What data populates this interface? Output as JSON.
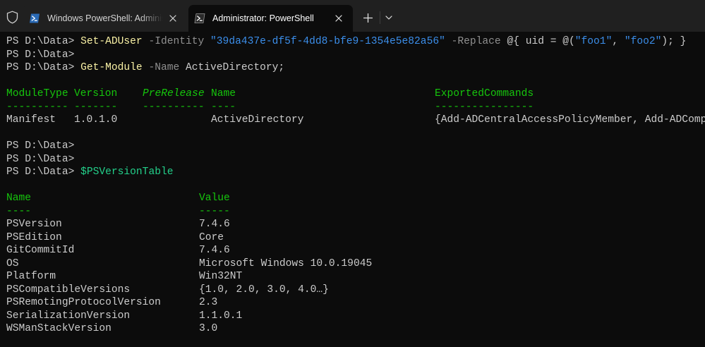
{
  "tabs": [
    {
      "title": "Windows PowerShell: Administrator: Windows PowerShell",
      "active": false
    },
    {
      "title": "Administrator: PowerShell",
      "active": true
    }
  ],
  "icons": {
    "shield": "shield-icon",
    "powershell": "powershell-icon",
    "close": "close-icon",
    "new_tab": "plus-icon",
    "dropdown": "chevron-down-icon"
  },
  "colors": {
    "background": "#0c0c0c",
    "tabbar": "#202020",
    "text": "#cccccc",
    "command": "#f9f1a5",
    "parameter": "#909090",
    "string": "#3b8eea",
    "variable": "#23d18b",
    "table_header": "#16c60c"
  },
  "terminal": {
    "prompt": "PS D:\\Data>",
    "line1": {
      "cmdlet": "Set-ADUser",
      "param_identity": "-Identity",
      "identity_value": "\"39da437e-df5f-4dd8-bfe9-1354e5e82a56\"",
      "param_replace": "-Replace",
      "hash_open": "@{ uid = @(",
      "value1": "\"foo1\"",
      "comma": ", ",
      "value2": "\"foo2\"",
      "hash_close": "); }"
    },
    "line3": {
      "cmdlet": "Get-Module",
      "param_name": "-Name",
      "name_value": "ActiveDirectory;"
    },
    "module_table": {
      "headers": {
        "module_type": "ModuleType",
        "version": "Version",
        "prerelease": "PreRelease",
        "name": "Name",
        "exported_commands": "ExportedCommands"
      },
      "underlines": {
        "module_type": "----------",
        "version": "-------",
        "prerelease": "----------",
        "name": "----",
        "exported_commands": "----------------"
      },
      "row": {
        "module_type": "Manifest",
        "version": "1.0.1.0",
        "prerelease": "",
        "name": "ActiveDirectory",
        "exported_commands": "{Add-ADCentralAccessPolicyMember, Add-ADComputerServiceAccount, Add-ADDomainControllerPasswordReplicationPolicy, Add-ADFineGrainedPasswordPolicySubject…}"
      }
    },
    "line_var": "$PSVersionTable",
    "version_table": {
      "headers": {
        "name": "Name",
        "value": "Value"
      },
      "underlines": {
        "name": "----",
        "value": "-----"
      },
      "rows": [
        {
          "name": "PSVersion",
          "value": "7.4.6"
        },
        {
          "name": "PSEdition",
          "value": "Core"
        },
        {
          "name": "GitCommitId",
          "value": "7.4.6"
        },
        {
          "name": "OS",
          "value": "Microsoft Windows 10.0.19045"
        },
        {
          "name": "Platform",
          "value": "Win32NT"
        },
        {
          "name": "PSCompatibleVersions",
          "value": "{1.0, 2.0, 3.0, 4.0…}"
        },
        {
          "name": "PSRemotingProtocolVersion",
          "value": "2.3"
        },
        {
          "name": "SerializationVersion",
          "value": "1.1.0.1"
        },
        {
          "name": "WSManStackVersion",
          "value": "3.0"
        }
      ]
    }
  }
}
